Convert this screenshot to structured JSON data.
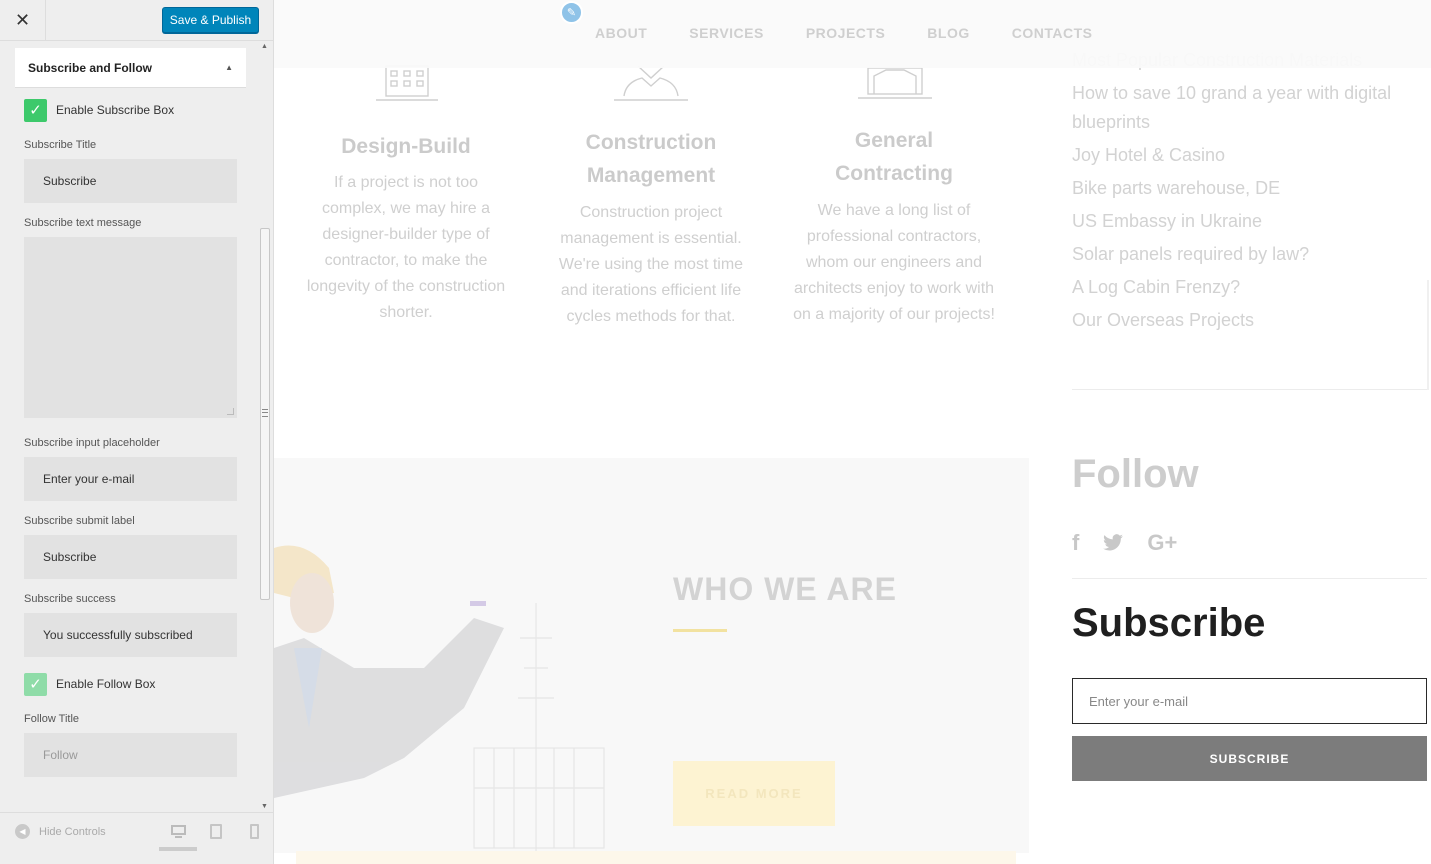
{
  "customizer": {
    "close_icon": "close-icon",
    "publish_label": "Save & Publish",
    "section_title": "Subscribe and Follow",
    "enable_subscribe_label": "Enable Subscribe Box",
    "enable_subscribe_checked": true,
    "subscribe_title_label": "Subscribe Title",
    "subscribe_title_value": "Subscribe",
    "subscribe_text_label": "Subscribe text message",
    "subscribe_text_value": "",
    "placeholder_label": "Subscribe input placeholder",
    "placeholder_value": "Enter your e-mail",
    "submit_label_label": "Subscribe submit label",
    "submit_label_value": "Subscribe",
    "success_label": "Subscribe success",
    "success_value": "You successfully subscribed",
    "enable_follow_label": "Enable Follow Box",
    "enable_follow_checked": true,
    "follow_title_label": "Follow Title",
    "follow_title_value": "Follow",
    "hide_controls_label": "Hide Controls",
    "devices": [
      "desktop-icon",
      "tablet-icon",
      "mobile-icon"
    ],
    "accent_color": "#0085ba",
    "check_color": "#3dc96b"
  },
  "preview": {
    "nav": [
      "ABOUT",
      "SERVICES",
      "PROJECTS",
      "BLOG",
      "CONTACTS"
    ],
    "services": [
      {
        "title": "Design-Build",
        "text": "If a project is not too complex, we may hire a designer-builder type of contractor, to make the longevity of the construction shorter."
      },
      {
        "title": "Construction Management",
        "text": "Construction project management is essential. We're using the most time and iterations efficient life cycles methods for that."
      },
      {
        "title": "General Contracting",
        "text": "We have a long list of professional contractors, whom our engineers and architects enjoy to work with on a majority of our projects!"
      }
    ],
    "recent_posts": [
      "Most Popular Construction Materials",
      "How to save 10 grand a year with digital blueprints",
      "Joy Hotel & Casino",
      "Bike parts warehouse, DE",
      "US Embassy in Ukraine",
      "Solar panels required by law?",
      "A Log Cabin Frenzy?",
      "Our Overseas Projects"
    ],
    "about_title": "WHO WE ARE",
    "read_more": "READ MORE",
    "follow_title": "Follow",
    "social_icons": [
      "facebook-icon",
      "twitter-icon",
      "google-plus-icon"
    ],
    "subscribe_title": "Subscribe",
    "subscribe_placeholder": "Enter your e-mail",
    "subscribe_button": "SUBSCRIBE"
  }
}
